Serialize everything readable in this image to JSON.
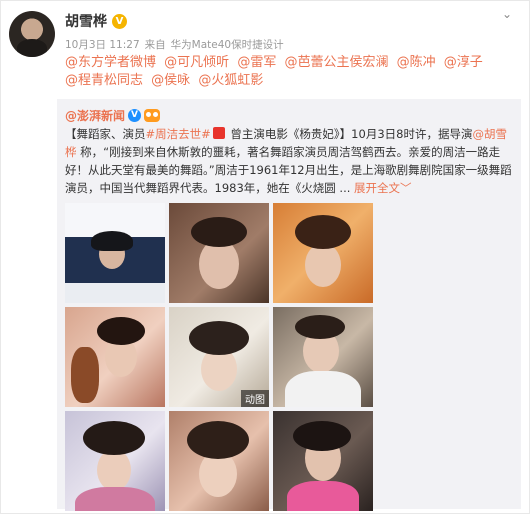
{
  "author": {
    "name": "胡雪桦",
    "verified_badge": "V"
  },
  "meta": {
    "date": "10月3日 11:27",
    "source_prefix": "来自",
    "device": "华为Mate40保时捷设计"
  },
  "mentions": [
    "@东方学者微博",
    "@可凡倾听",
    "@雷军",
    "@芭蕾公主侯宏澜",
    "@陈冲",
    "@淳子",
    "@程青松同志",
    "@侯咏",
    "@火狐虹影"
  ],
  "repost": {
    "source_name": "@澎湃新闻",
    "verified_badge": "V",
    "text": {
      "p1": "【舞蹈家、演员",
      "topic": "#周洁去世#",
      "p2": " 曾主演电影《杨贵妃》】10月3日8时许，据导演",
      "mention": "@胡雪桦",
      "p3": " 称，“刚接到来自休斯敦的噩耗，著名舞蹈家演员周洁驾鹤西去。亲爱的周洁一路走好！从此天堂有最美的舞蹈。”周洁于1961年12月出生，是上海歌剧舞剧院国家一级舞蹈演员，中国当代舞蹈界代表。1983年，她在《火烧圆",
      "ellipsis": "...",
      "expand": "展开全文",
      "expand_icon": "﹀"
    },
    "gif_label": "动图"
  },
  "colors": {
    "accent": "#eb7350",
    "repost_bg": "#f2f2f5",
    "verified_gold": "#f5b400",
    "verified_blue": "#1e90ff"
  },
  "icons": {
    "chevron": "chevron-down-icon",
    "owl": "owl-badge-icon",
    "gift": "gift-icon"
  }
}
